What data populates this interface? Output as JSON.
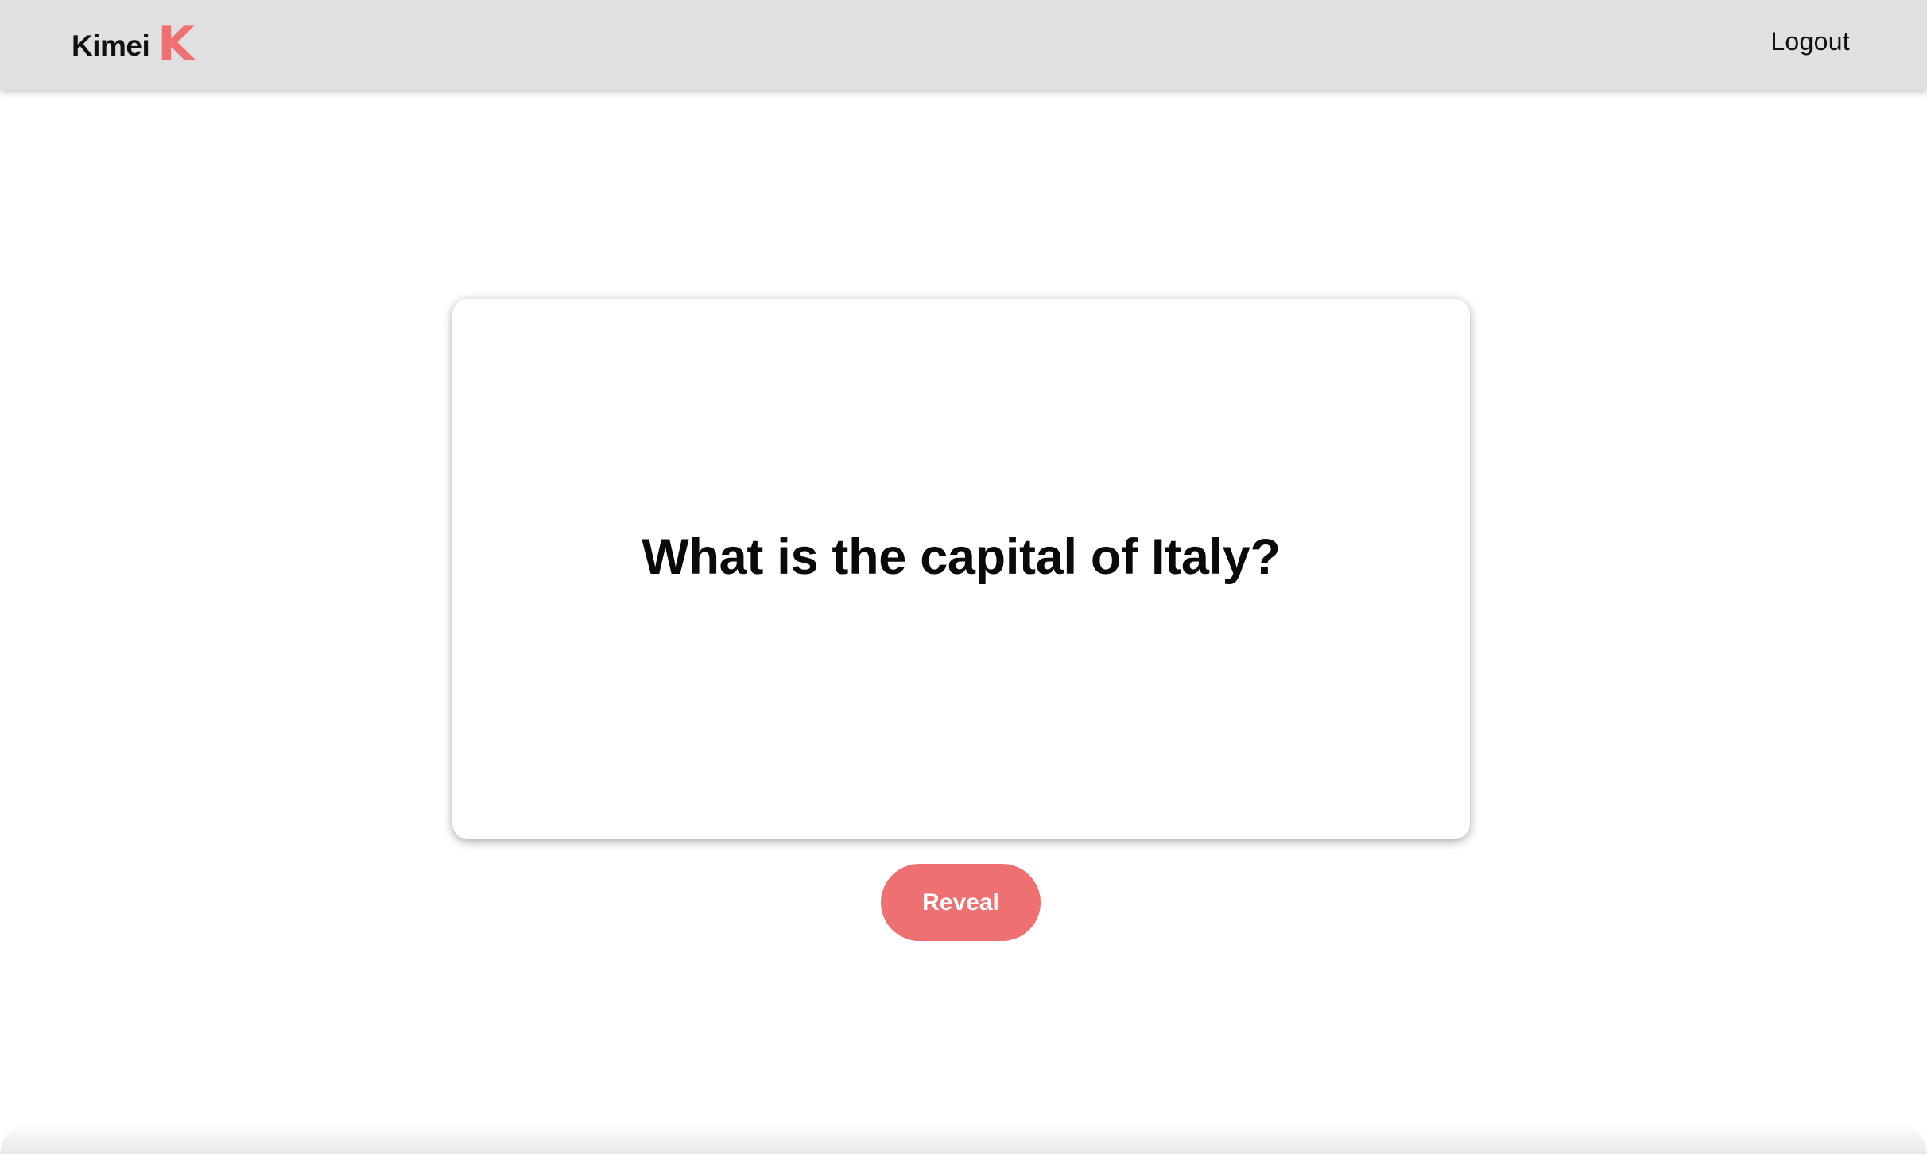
{
  "navbar": {
    "brand_name": "Kimei",
    "brand_logo_letter": "K",
    "logout_label": "Logout"
  },
  "flashcard": {
    "question": "What is the capital of Italy?"
  },
  "actions": {
    "reveal_label": "Reveal"
  },
  "colors": {
    "accent": "#ee7070",
    "navbar_bg": "#e0e0e0",
    "page_bg": "#ffffff"
  }
}
